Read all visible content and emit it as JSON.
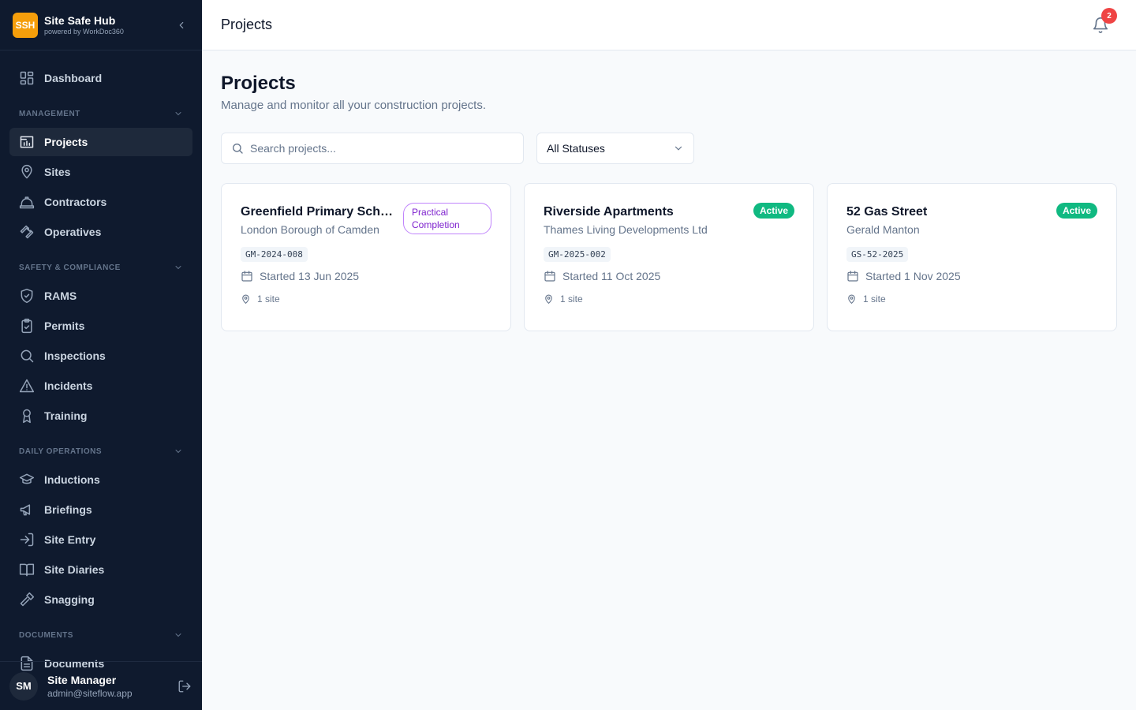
{
  "brand": {
    "logo": "SSH",
    "title": "Site Safe Hub",
    "subtitle": "powered by WorkDoc360"
  },
  "sidebar": {
    "dashboard": "Dashboard",
    "sections": [
      {
        "title": "MANAGEMENT",
        "items": [
          {
            "label": "Projects",
            "icon": "projects-icon",
            "active": true
          },
          {
            "label": "Sites",
            "icon": "map-pin-icon"
          },
          {
            "label": "Contractors",
            "icon": "hard-hat-icon"
          },
          {
            "label": "Operatives",
            "icon": "wrench-icon"
          }
        ]
      },
      {
        "title": "SAFETY & COMPLIANCE",
        "items": [
          {
            "label": "RAMS",
            "icon": "shield-check-icon"
          },
          {
            "label": "Permits",
            "icon": "clipboard-check-icon"
          },
          {
            "label": "Inspections",
            "icon": "search-icon"
          },
          {
            "label": "Incidents",
            "icon": "alert-triangle-icon"
          },
          {
            "label": "Training",
            "icon": "award-icon"
          }
        ]
      },
      {
        "title": "DAILY OPERATIONS",
        "items": [
          {
            "label": "Inductions",
            "icon": "graduation-cap-icon"
          },
          {
            "label": "Briefings",
            "icon": "megaphone-icon"
          },
          {
            "label": "Site Entry",
            "icon": "log-in-icon"
          },
          {
            "label": "Site Diaries",
            "icon": "book-open-icon"
          },
          {
            "label": "Snagging",
            "icon": "hammer-icon"
          }
        ]
      },
      {
        "title": "DOCUMENTS",
        "items": [
          {
            "label": "Documents",
            "icon": "file-text-icon"
          }
        ]
      }
    ]
  },
  "user": {
    "initials": "SM",
    "name": "Site Manager",
    "email": "admin@siteflow.app"
  },
  "topbar": {
    "title": "Projects",
    "notifications": "2"
  },
  "page": {
    "title": "Projects",
    "subtitle": "Manage and monitor all your construction projects."
  },
  "filters": {
    "search_placeholder": "Search projects...",
    "status": "All Statuses"
  },
  "projects": [
    {
      "name": "Greenfield Primary School ...",
      "client": "London Borough of Camden",
      "code": "GM-2024-008",
      "started": "Started 13 Jun 2025",
      "sites": "1 site",
      "status": "Practical Completion",
      "status_type": "pc"
    },
    {
      "name": "Riverside Apartments",
      "client": "Thames Living Developments Ltd",
      "code": "GM-2025-002",
      "started": "Started 11 Oct 2025",
      "sites": "1 site",
      "status": "Active",
      "status_type": "active"
    },
    {
      "name": "52 Gas Street",
      "client": "Gerald Manton",
      "code": "GS-52-2025",
      "started": "Started 1 Nov 2025",
      "sites": "1 site",
      "status": "Active",
      "status_type": "active"
    }
  ],
  "colors": {
    "sidebar_bg": "#0f1a2e",
    "brand": "#f59e0b",
    "active_badge": "#10b981",
    "pc_badge": "#7e22ce",
    "notif_badge": "#ef4444"
  }
}
